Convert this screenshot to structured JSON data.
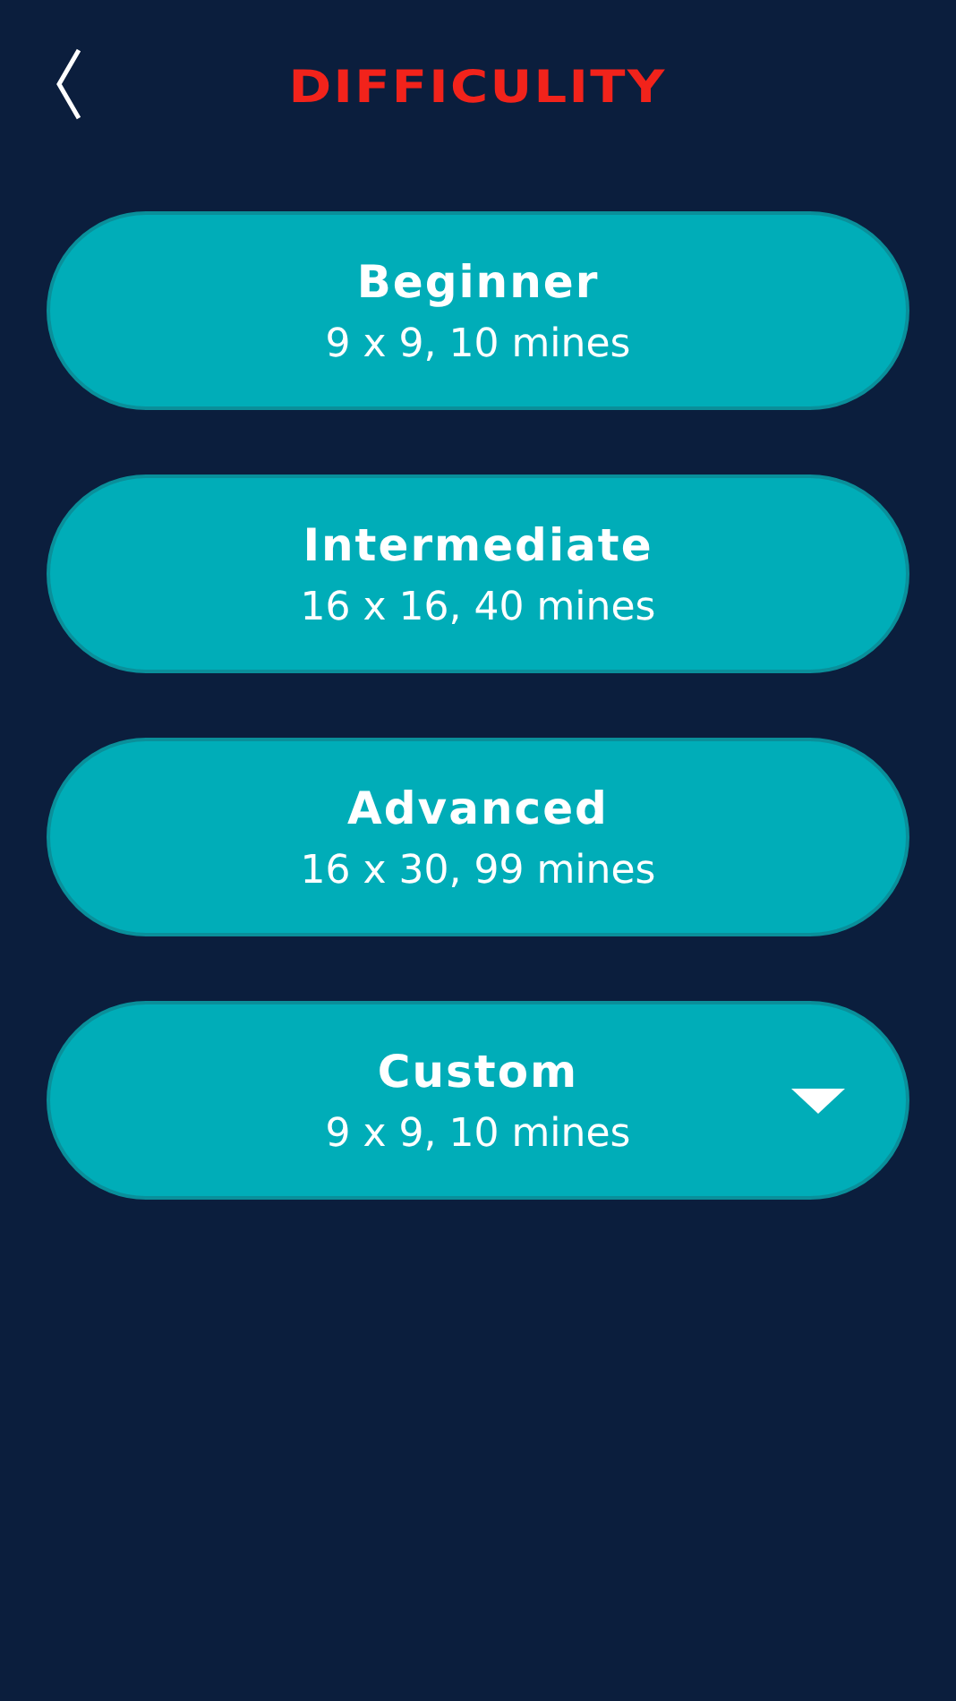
{
  "header": {
    "title": "DIFFICULITY"
  },
  "levels": [
    {
      "kind": "preset",
      "name": "Beginner",
      "detail": "9 x 9, 10 mines"
    },
    {
      "kind": "preset",
      "name": "Intermediate",
      "detail": "16 x 16, 40 mines"
    },
    {
      "kind": "preset",
      "name": "Advanced",
      "detail": "16 x 30, 99 mines"
    },
    {
      "kind": "custom",
      "name": "Custom",
      "detail": "9 x 9, 10 mines"
    }
  ]
}
